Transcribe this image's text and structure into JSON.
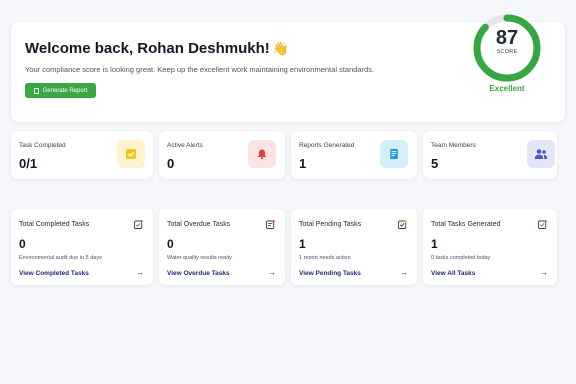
{
  "welcome": {
    "title": "Welcome back, Rohan Deshmukh!",
    "wave": "👋",
    "subtitle": "Your compliance score is looking great. Keep up the excellent work maintaining environmental standards.",
    "button_label": "Generate Report"
  },
  "score": {
    "value": "87",
    "label": "SCORE",
    "status": "Excellent",
    "progress_fraction": 0.87,
    "color": "#36a642"
  },
  "stats": [
    {
      "title": "Task Completed",
      "value": "0/1",
      "icon": "checkbox-icon",
      "color": "#f5c518"
    },
    {
      "title": "Active Alerts",
      "value": "0",
      "icon": "bell-icon",
      "color": "#e53e3e"
    },
    {
      "title": "Reports Generated",
      "value": "1",
      "icon": "document-icon",
      "color": "#1a9bd7"
    },
    {
      "title": "Team Members",
      "value": "5",
      "icon": "users-icon",
      "color": "#4b55c4"
    }
  ],
  "tasks": [
    {
      "title": "Total Completed Tasks",
      "value": "0",
      "note": "Environmental audit due in 5 days",
      "link": "View Completed Tasks",
      "icon": "task-check-icon"
    },
    {
      "title": "Total Overdue Tasks",
      "value": "0",
      "note": "Water quality results ready",
      "link": "View Overdue Tasks",
      "icon": "task-alert-icon"
    },
    {
      "title": "Total Pending Tasks",
      "value": "1",
      "note": "1 report needs action",
      "link": "View Pending Tasks",
      "icon": "task-pending-icon"
    },
    {
      "title": "Total Tasks Generated",
      "value": "1",
      "note": "0 tasks completed today",
      "link": "View All Tasks",
      "icon": "task-generated-icon"
    }
  ]
}
